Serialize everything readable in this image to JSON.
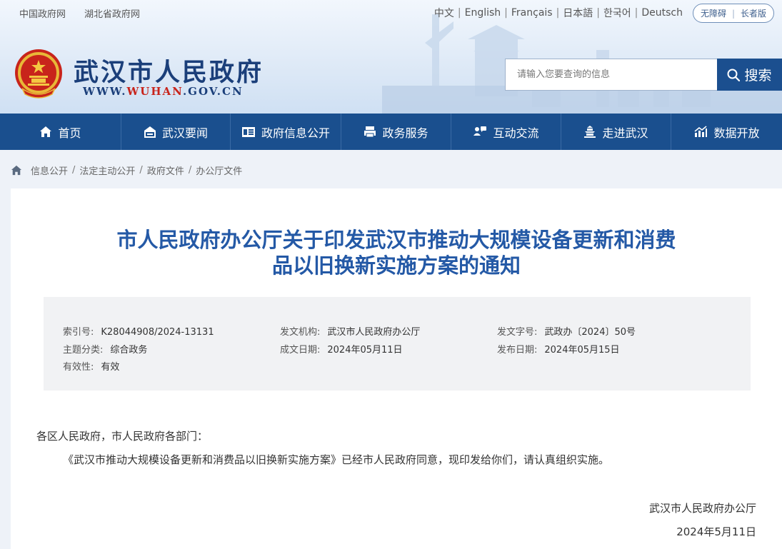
{
  "top_links": [
    "中国政府网",
    "湖北省政府网"
  ],
  "languages": [
    "中文",
    "English",
    "Français",
    "日本語",
    "한국어",
    "Deutsch"
  ],
  "accessibility": {
    "barrier_free": "无障碍",
    "elder": "长者版"
  },
  "site": {
    "title": "武汉市人民政府",
    "url_prefix": "WWW.",
    "url_highlight": "WUHAN",
    "url_suffix": ".GOV.CN"
  },
  "search": {
    "placeholder": "请输入您要查询的信息",
    "button": "搜索"
  },
  "nav": [
    {
      "label": "首页",
      "icon": "home-icon"
    },
    {
      "label": "武汉要闻",
      "icon": "news-icon"
    },
    {
      "label": "政府信息公开",
      "icon": "info-card-icon"
    },
    {
      "label": "政务服务",
      "icon": "printer-icon"
    },
    {
      "label": "互动交流",
      "icon": "chat-icon"
    },
    {
      "label": "走进武汉",
      "icon": "tower-icon"
    },
    {
      "label": "数据开放",
      "icon": "chart-icon"
    }
  ],
  "breadcrumb": [
    "信息公开",
    "法定主动公开",
    "政府文件",
    "办公厅文件"
  ],
  "doc": {
    "title_line1": "市人民政府办公厅关于印发武汉市推动大规模设备更新和消费",
    "title_line2": "品以旧换新实施方案的通知"
  },
  "meta": {
    "index_label": "索引号:",
    "index_value": "K28044908/2024-13131",
    "issuer_label": "发文机构:",
    "issuer_value": "武汉市人民政府办公厅",
    "docno_label": "发文字号:",
    "docno_value": "武政办〔2024〕50号",
    "topic_label": "主题分类:",
    "topic_value": "综合政务",
    "created_label": "成文日期:",
    "created_value": "2024年05月11日",
    "published_label": "发布日期:",
    "published_value": "2024年05月15日",
    "validity_label": "有效性:",
    "validity_value": "有效"
  },
  "body": {
    "salutation": "各区人民政府，市人民政府各部门：",
    "paragraph": "《武汉市推动大规模设备更新和消费品以旧换新实施方案》已经市人民政府同意，现印发给你们，请认真组织实施。",
    "signature": "武汉市人民政府办公厅",
    "date": "2024年5月11日"
  },
  "colors": {
    "nav_bg": "#1a4f8e",
    "title_blue": "#2459a6",
    "brand_navy": "#1b3f7a",
    "accent_red": "#c8241b"
  }
}
